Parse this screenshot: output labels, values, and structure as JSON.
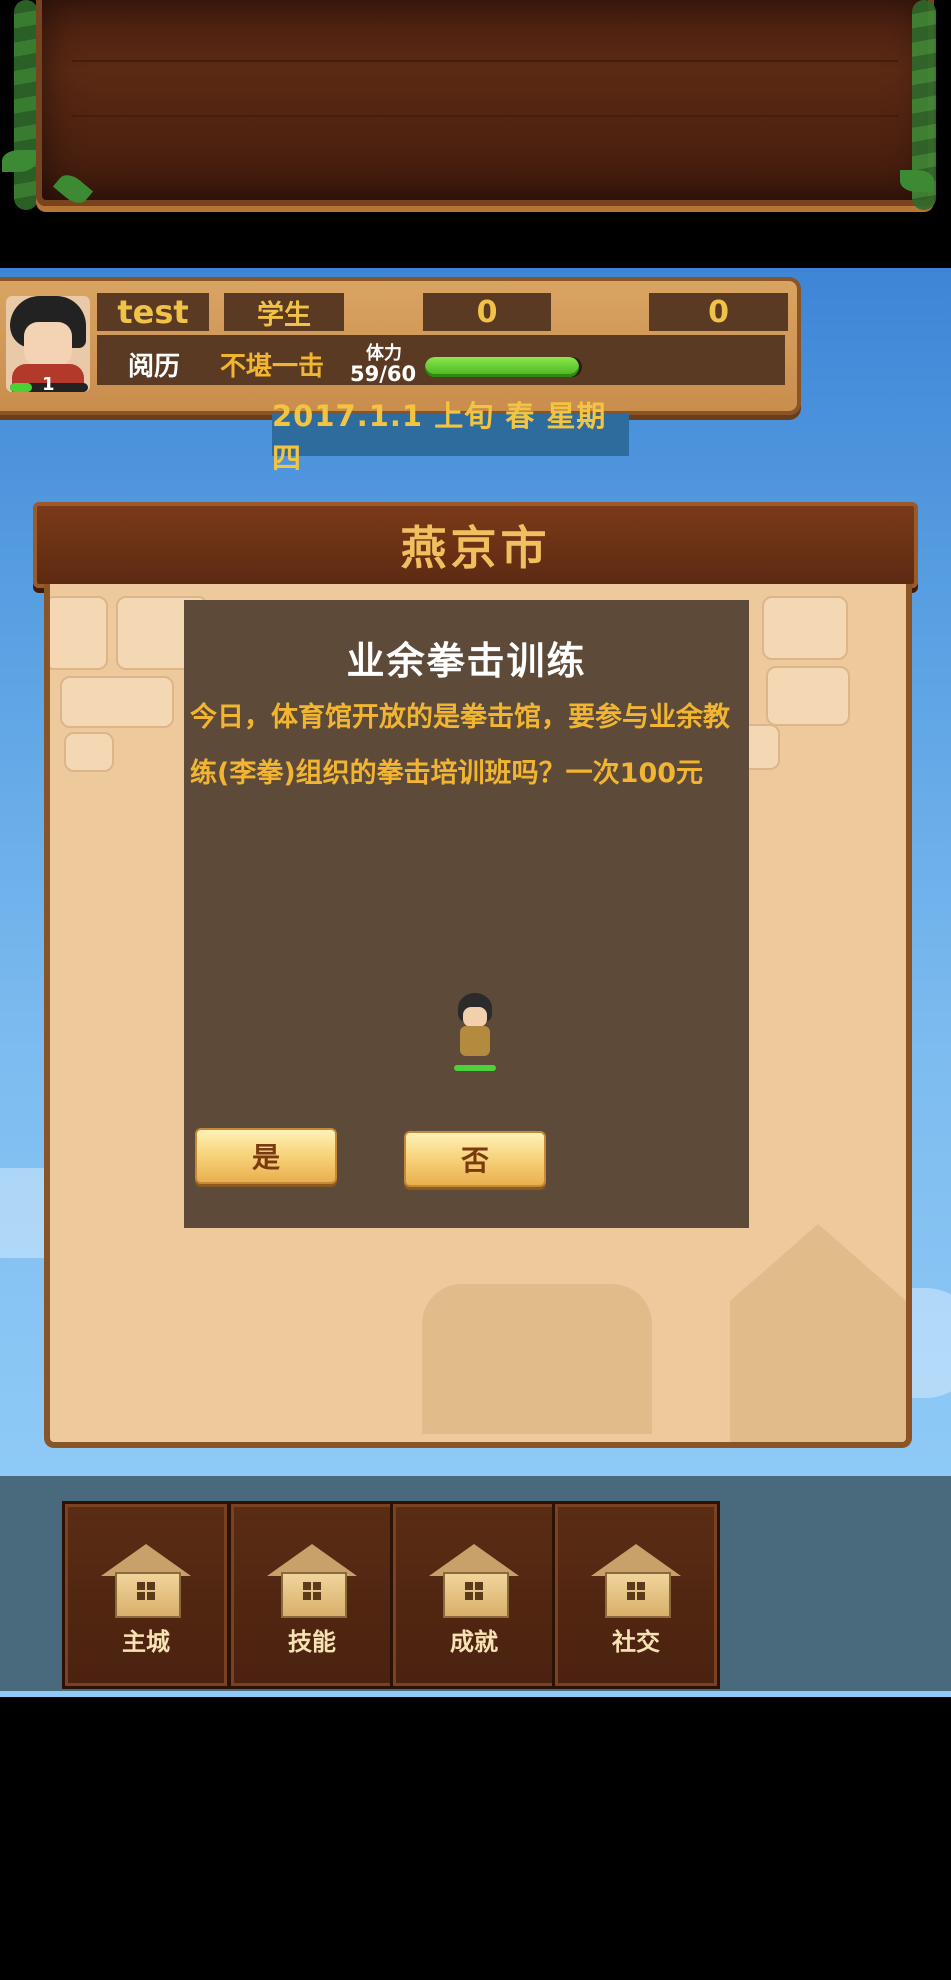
{
  "player": {
    "name": "test",
    "role": "学生",
    "stat1": "0",
    "stat2": "0",
    "level": "1",
    "experience_label": "阅历",
    "experience_value": "不堪一击",
    "stamina_label": "体力",
    "stamina_value": "59/60",
    "stamina_fraction": 0.98
  },
  "date": "2017.1.1  上旬 春 星期四",
  "city": {
    "title": "燕京市"
  },
  "event": {
    "title": "业余拳击训练",
    "description": "今日，体育馆开放的是拳击馆，要参与业余教练(李拳)组织的拳击培训班吗？一次100元",
    "yes_label": "是",
    "no_label": "否"
  },
  "nav": {
    "items": [
      {
        "label": "主城",
        "icon": "house-icon"
      },
      {
        "label": "技能",
        "icon": "house-icon"
      },
      {
        "label": "成就",
        "icon": "house-icon"
      },
      {
        "label": "社交",
        "icon": "house-icon"
      }
    ]
  },
  "colors": {
    "accent_gold": "#f2b531",
    "panel_brown": "#5a3a22",
    "sky_blue": "#7dbcf0"
  }
}
